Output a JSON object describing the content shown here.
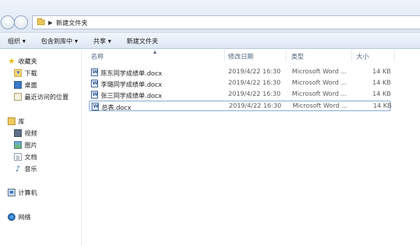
{
  "address": {
    "crumbs": [
      "新建文件夹"
    ]
  },
  "toolbar": {
    "items": [
      {
        "label": "组织",
        "dropdown": true
      },
      {
        "label": "包含到库中",
        "dropdown": true
      },
      {
        "label": "共享",
        "dropdown": true
      },
      {
        "label": "新建文件夹",
        "dropdown": false
      }
    ]
  },
  "nav": {
    "favorites": "收藏夹",
    "downloads": "下载",
    "desktop": "桌面",
    "recent": "最近访问的位置",
    "libraries": "库",
    "videos": "视频",
    "pictures": "图片",
    "documents": "文档",
    "music": "音乐",
    "computer": "计算机",
    "network": "网络"
  },
  "columns": {
    "name": "名称",
    "modified": "修改日期",
    "type": "类型",
    "size": "大小"
  },
  "files": [
    {
      "name": "陈东同学成绩单.docx",
      "modified": "2019/4/22 16:30",
      "type": "Microsoft Word ...",
      "size": "14 KB"
    },
    {
      "name": "李璐同学成绩单.docx",
      "modified": "2019/4/22 16:30",
      "type": "Microsoft Word ...",
      "size": "14 KB"
    },
    {
      "name": "张三同学成绩单.docx",
      "modified": "2019/4/22 16:30",
      "type": "Microsoft Word ...",
      "size": "14 KB"
    },
    {
      "name": "总表.docx",
      "modified": "2019/4/22 16:30",
      "type": "Microsoft Word ...",
      "size": "14 KB"
    }
  ],
  "icons": {
    "back": "back-arrow-icon",
    "forward": "forward-arrow-icon",
    "folder": "folder-icon",
    "word": "word-document-icon"
  }
}
